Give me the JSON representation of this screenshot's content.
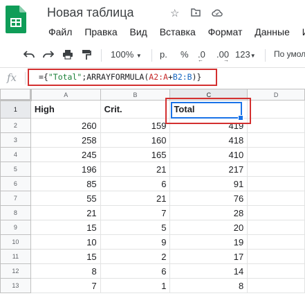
{
  "header": {
    "title": "Новая таблица",
    "icons": [
      "star-icon",
      "folder-icon",
      "cloud-icon"
    ]
  },
  "menu": [
    "Файл",
    "Правка",
    "Вид",
    "Вставка",
    "Формат",
    "Данные",
    "Ин"
  ],
  "toolbar": {
    "zoom": "100%",
    "currency": "р.",
    "percent": "%",
    "dec_decrease": ".0",
    "dec_increase": ".00",
    "format_more": "123",
    "font": "По умол"
  },
  "formula_bar": {
    "fx": "fx",
    "formula_prefix": "={",
    "formula_string": "\"Total\"",
    "formula_mid": ";ARRAYFORMULA(",
    "formula_ref1": "A2:A",
    "formula_plus": "+",
    "formula_ref2": "B2:B",
    "formula_suffix": ")}"
  },
  "columns": [
    "A",
    "B",
    "C",
    "D"
  ],
  "row_numbers": [
    "1",
    "2",
    "3",
    "4",
    "5",
    "6",
    "7",
    "8",
    "9",
    "10",
    "11",
    "12",
    "13"
  ],
  "header_row": [
    "High",
    "Crit.",
    "Total"
  ],
  "rows": [
    [
      "260",
      "159",
      "419"
    ],
    [
      "258",
      "160",
      "418"
    ],
    [
      "245",
      "165",
      "410"
    ],
    [
      "196",
      "21",
      "217"
    ],
    [
      "85",
      "6",
      "91"
    ],
    [
      "55",
      "21",
      "76"
    ],
    [
      "21",
      "7",
      "28"
    ],
    [
      "15",
      "5",
      "20"
    ],
    [
      "10",
      "9",
      "19"
    ],
    [
      "15",
      "2",
      "17"
    ],
    [
      "8",
      "6",
      "14"
    ],
    [
      "7",
      "1",
      "8"
    ]
  ],
  "colors": {
    "accent": "#1a73e8",
    "annotation": "#d32f2f",
    "logo": "#0f9d58"
  }
}
